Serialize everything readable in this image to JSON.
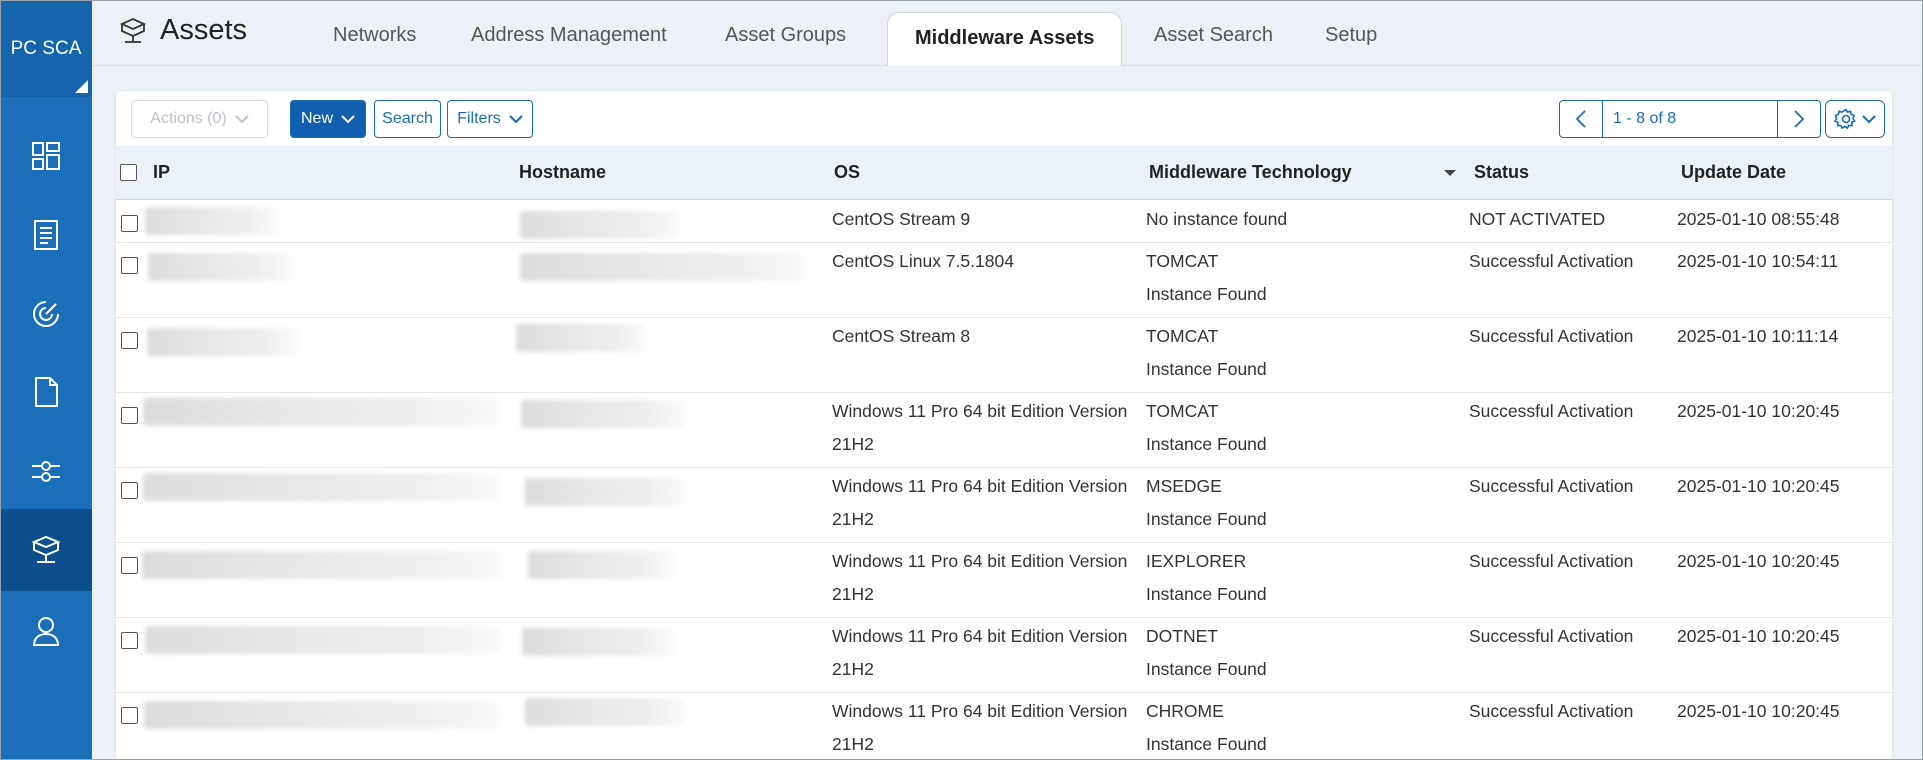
{
  "sidebar": {
    "brand": "PC SCA",
    "items": [
      {
        "icon": "dashboard-icon"
      },
      {
        "icon": "report-list-icon"
      },
      {
        "icon": "scan-radar-icon"
      },
      {
        "icon": "document-icon"
      },
      {
        "icon": "connections-icon"
      },
      {
        "icon": "assets-icon",
        "active": true
      },
      {
        "icon": "user-icon"
      }
    ]
  },
  "header": {
    "title": "Assets",
    "tabs": [
      {
        "label": "Networks"
      },
      {
        "label": "Address Management"
      },
      {
        "label": "Asset Groups"
      },
      {
        "label": "Middleware Assets",
        "active": true
      },
      {
        "label": "Asset Search"
      },
      {
        "label": "Setup"
      }
    ]
  },
  "toolbar": {
    "actions_label": "Actions (0)",
    "new_label": "New",
    "search_label": "Search",
    "filters_label": "Filters",
    "pagination": "1 - 8 of 8"
  },
  "table": {
    "columns": [
      "IP",
      "Hostname",
      "OS",
      "Middleware Technology",
      "Status",
      "Update Date"
    ],
    "sorted_column": "Middleware Technology",
    "rows": [
      {
        "ip": "",
        "hostname": "",
        "os": [
          "CentOS Stream 9"
        ],
        "tech": [
          "No instance found"
        ],
        "status": "NOT ACTIVATED",
        "date": "2025-01-10 08:55:48"
      },
      {
        "ip": "",
        "hostname": "",
        "os": [
          "CentOS Linux 7.5.1804"
        ],
        "tech": [
          "TOMCAT",
          "Instance Found"
        ],
        "status": "Successful Activation",
        "date": "2025-01-10 10:54:11"
      },
      {
        "ip": "",
        "hostname": "",
        "os": [
          "CentOS Stream 8"
        ],
        "tech": [
          "TOMCAT",
          "Instance Found"
        ],
        "status": "Successful Activation",
        "date": "2025-01-10 10:11:14"
      },
      {
        "ip": "",
        "hostname": "",
        "os": [
          "Windows 11 Pro 64 bit Edition Version",
          "21H2"
        ],
        "tech": [
          "TOMCAT",
          "Instance Found"
        ],
        "status": "Successful Activation",
        "date": "2025-01-10 10:20:45"
      },
      {
        "ip": "",
        "hostname": "",
        "os": [
          "Windows 11 Pro 64 bit Edition Version",
          "21H2"
        ],
        "tech": [
          "MSEDGE",
          "Instance Found"
        ],
        "status": "Successful Activation",
        "date": "2025-01-10 10:20:45"
      },
      {
        "ip": "",
        "hostname": "",
        "os": [
          "Windows 11 Pro 64 bit Edition Version",
          "21H2"
        ],
        "tech": [
          "IEXPLORER",
          "Instance Found"
        ],
        "status": "Successful Activation",
        "date": "2025-01-10 10:20:45"
      },
      {
        "ip": "",
        "hostname": "",
        "os": [
          "Windows 11 Pro 64 bit Edition Version",
          "21H2"
        ],
        "tech": [
          "DOTNET",
          "Instance Found"
        ],
        "status": "Successful Activation",
        "date": "2025-01-10 10:20:45"
      },
      {
        "ip": "",
        "hostname": "",
        "os": [
          "Windows 11 Pro 64 bit Edition Version",
          "21H2"
        ],
        "tech": [
          "CHROME",
          "Instance Found"
        ],
        "status": "Successful Activation",
        "date": "2025-01-10 10:20:45"
      }
    ]
  },
  "colors": {
    "sidebar": "#1a6fb8",
    "sidebar_active": "#0c4f8d",
    "accent": "#1b6bb5",
    "header_bg": "#ecf1f7"
  }
}
